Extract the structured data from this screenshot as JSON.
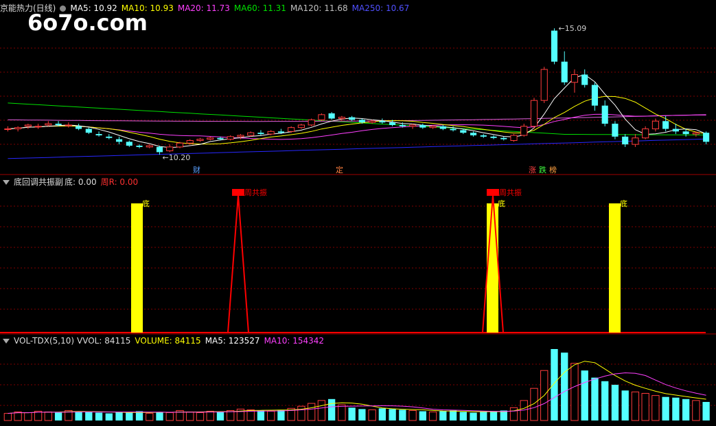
{
  "watermark": "6o7o.com",
  "main_header": {
    "title": "京能热力(日线)",
    "ma5": "MA5: 10.92",
    "ma10": "MA10: 10.93",
    "ma20": "MA20: 11.73",
    "ma60": "MA60: 11.31",
    "ma120": "MA120: 11.68",
    "ma250": "MA250: 10.67"
  },
  "ind_header": {
    "title": "底回调共振副",
    "di": "底: 0.00",
    "zhouR": "周R: 0.00"
  },
  "vol_header": {
    "title": "VOL-TDX(5,10)",
    "vvol": "VVOL: 84115",
    "volume": "VOLUME: 84115",
    "ma5": "MA5: 123527",
    "ma10": "MA10: 154342"
  },
  "colors": {
    "up": "#ff3c3c",
    "down": "#54ffff",
    "ma5": "#ffffff",
    "ma10": "#ffff00",
    "ma20": "#ff40ff",
    "ma60": "#00e000",
    "ma120": "#c0c0c0",
    "ma250": "#2828ff",
    "bar": "#ffff00",
    "line": "#ff0000",
    "grid": "#800000"
  },
  "chart_data": [
    {
      "type": "candlestick",
      "annotations": {
        "high": "15.09",
        "low": "10.20"
      },
      "markers": [
        "财",
        "定",
        "涨",
        "跌",
        "榜"
      ],
      "candles": [
        [
          11.2,
          11.3,
          11.1,
          11.2
        ],
        [
          11.2,
          11.3,
          11.1,
          11.25
        ],
        [
          11.3,
          11.4,
          11.2,
          11.35
        ],
        [
          11.3,
          11.4,
          11.2,
          11.3
        ],
        [
          11.35,
          11.5,
          11.3,
          11.4
        ],
        [
          11.4,
          11.5,
          11.3,
          11.35
        ],
        [
          11.35,
          11.45,
          11.25,
          11.35
        ],
        [
          11.3,
          11.4,
          11.15,
          11.2
        ],
        [
          11.2,
          11.25,
          11.0,
          11.05
        ],
        [
          11.0,
          11.1,
          10.9,
          10.95
        ],
        [
          10.9,
          11.0,
          10.8,
          10.85
        ],
        [
          10.8,
          10.9,
          10.6,
          10.7
        ],
        [
          10.7,
          10.75,
          10.5,
          10.55
        ],
        [
          10.55,
          10.6,
          10.45,
          10.5
        ],
        [
          10.5,
          10.6,
          10.45,
          10.55
        ],
        [
          10.5,
          10.55,
          10.2,
          10.3
        ],
        [
          10.35,
          10.6,
          10.3,
          10.5
        ],
        [
          10.5,
          10.7,
          10.45,
          10.65
        ],
        [
          10.65,
          10.8,
          10.6,
          10.75
        ],
        [
          10.75,
          10.85,
          10.7,
          10.8
        ],
        [
          10.8,
          10.9,
          10.75,
          10.85
        ],
        [
          10.85,
          10.9,
          10.75,
          10.8
        ],
        [
          10.8,
          10.95,
          10.75,
          10.9
        ],
        [
          10.9,
          11.0,
          10.8,
          10.95
        ],
        [
          10.95,
          11.1,
          10.9,
          11.05
        ],
        [
          11.05,
          11.15,
          10.95,
          11.0
        ],
        [
          11.0,
          11.15,
          10.95,
          11.1
        ],
        [
          11.1,
          11.2,
          11.0,
          11.05
        ],
        [
          11.1,
          11.3,
          11.05,
          11.25
        ],
        [
          11.25,
          11.4,
          11.2,
          11.35
        ],
        [
          11.35,
          11.6,
          11.3,
          11.55
        ],
        [
          11.55,
          11.8,
          11.5,
          11.75
        ],
        [
          11.8,
          11.85,
          11.55,
          11.6
        ],
        [
          11.6,
          11.7,
          11.5,
          11.65
        ],
        [
          11.65,
          11.7,
          11.5,
          11.55
        ],
        [
          11.55,
          11.6,
          11.4,
          11.45
        ],
        [
          11.45,
          11.55,
          11.4,
          11.5
        ],
        [
          11.5,
          11.6,
          11.4,
          11.45
        ],
        [
          11.45,
          11.55,
          11.3,
          11.35
        ],
        [
          11.35,
          11.45,
          11.25,
          11.3
        ],
        [
          11.3,
          11.4,
          11.2,
          11.35
        ],
        [
          11.35,
          11.4,
          11.2,
          11.25
        ],
        [
          11.25,
          11.35,
          11.2,
          11.3
        ],
        [
          11.3,
          11.35,
          11.15,
          11.2
        ],
        [
          11.2,
          11.3,
          11.1,
          11.15
        ],
        [
          11.15,
          11.2,
          11.0,
          11.05
        ],
        [
          11.05,
          11.1,
          10.9,
          10.95
        ],
        [
          10.95,
          11.0,
          10.85,
          10.9
        ],
        [
          10.9,
          10.95,
          10.8,
          10.85
        ],
        [
          10.85,
          10.9,
          10.75,
          10.8
        ],
        [
          10.75,
          11.0,
          10.7,
          10.95
        ],
        [
          10.95,
          11.4,
          10.9,
          11.3
        ],
        [
          11.3,
          12.4,
          11.2,
          12.3
        ],
        [
          12.3,
          13.6,
          12.2,
          13.5
        ],
        [
          15.0,
          15.09,
          13.7,
          13.8
        ],
        [
          13.8,
          14.2,
          12.9,
          13.0
        ],
        [
          13.0,
          13.5,
          12.6,
          13.3
        ],
        [
          13.3,
          13.5,
          12.8,
          12.9
        ],
        [
          12.9,
          13.0,
          11.9,
          12.1
        ],
        [
          12.1,
          12.3,
          11.3,
          11.4
        ],
        [
          11.4,
          11.5,
          10.8,
          10.9
        ],
        [
          10.9,
          11.0,
          10.5,
          10.6
        ],
        [
          10.6,
          11.0,
          10.5,
          10.85
        ],
        [
          10.85,
          11.3,
          10.8,
          11.2
        ],
        [
          11.2,
          11.6,
          11.1,
          11.5
        ],
        [
          11.5,
          11.7,
          11.1,
          11.2
        ],
        [
          11.2,
          11.4,
          11.0,
          11.1
        ],
        [
          11.1,
          11.2,
          10.9,
          11.0
        ],
        [
          11.0,
          11.1,
          10.9,
          11.05
        ],
        [
          11.05,
          11.1,
          10.6,
          10.7
        ]
      ]
    },
    {
      "type": "bar",
      "bars": [
        0.0,
        0.0,
        0.0,
        0.0
      ],
      "bar_labels": [
        "底",
        "底",
        "底"
      ],
      "spike_labels": [
        "周共振",
        "周共振"
      ]
    },
    {
      "type": "bar",
      "series_name": "VOLUME",
      "volumes": [
        10,
        12,
        11,
        13,
        12,
        11,
        14,
        13,
        12,
        11,
        10,
        12,
        11,
        13,
        10,
        12,
        11,
        14,
        12,
        11,
        13,
        12,
        14,
        16,
        15,
        14,
        13,
        15,
        17,
        20,
        24,
        28,
        30,
        22,
        18,
        16,
        15,
        17,
        16,
        15,
        14,
        13,
        12,
        13,
        14,
        12,
        11,
        12,
        13,
        14,
        18,
        28,
        45,
        70,
        100,
        95,
        80,
        70,
        60,
        55,
        50,
        42,
        40,
        38,
        35,
        33,
        32,
        30,
        28,
        26
      ]
    }
  ]
}
